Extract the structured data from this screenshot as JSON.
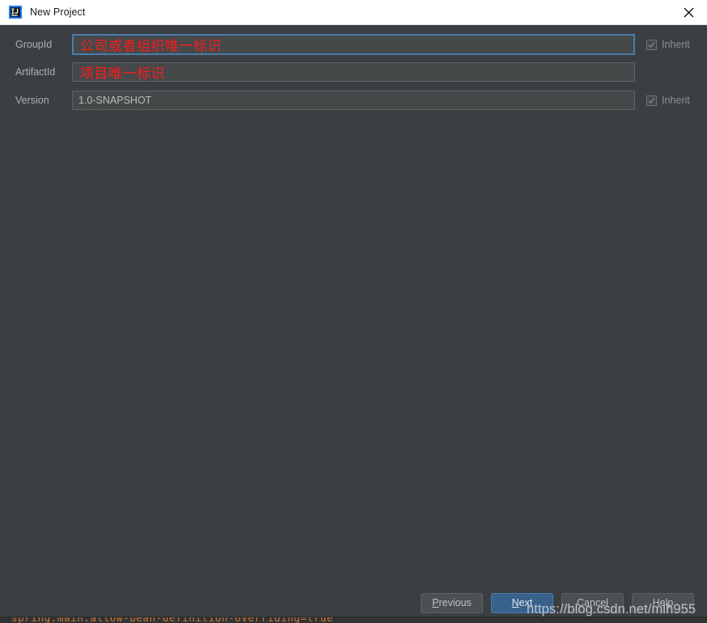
{
  "window": {
    "title": "New Project",
    "app_icon": "intellij-idea-icon",
    "close_icon": "close-icon",
    "colors": {
      "titlebar_bg": "#ffffff",
      "dialog_bg": "#3c3f41",
      "field_bg": "#45494a",
      "focus_border": "#4a7dab",
      "default_button": "#38618c",
      "annotation_red": "#ff1a1a",
      "console_orange": "#cc7832"
    }
  },
  "form": {
    "fields": [
      {
        "label": "GroupId",
        "value": "",
        "placeholder": "",
        "annotation": "公司或者组织唯一标识",
        "focused": true,
        "inherit": {
          "label": "Inherit",
          "checked": true,
          "enabled": false
        }
      },
      {
        "label": "ArtifactId",
        "value": "",
        "placeholder": "",
        "annotation": "项目唯一标识",
        "focused": false,
        "inherit": null
      },
      {
        "label": "Version",
        "value": "1.0-SNAPSHOT",
        "placeholder": "",
        "annotation": "",
        "focused": false,
        "inherit": {
          "label": "Inherit",
          "checked": true,
          "enabled": false
        }
      }
    ]
  },
  "buttons": {
    "previous": {
      "label": "Previous",
      "mnemonic": "P",
      "default": false
    },
    "next": {
      "label": "Next",
      "mnemonic": "N",
      "default": true
    },
    "cancel": {
      "label": "Cancel",
      "mnemonic": "C",
      "default": false
    },
    "help": {
      "label": "Help",
      "mnemonic": "H",
      "default": false
    }
  },
  "overlay": {
    "watermark": "https://blog.csdn.net/mlh955"
  },
  "background": {
    "console_text": "spring.main.allow-bean-definition-overriding=true"
  }
}
